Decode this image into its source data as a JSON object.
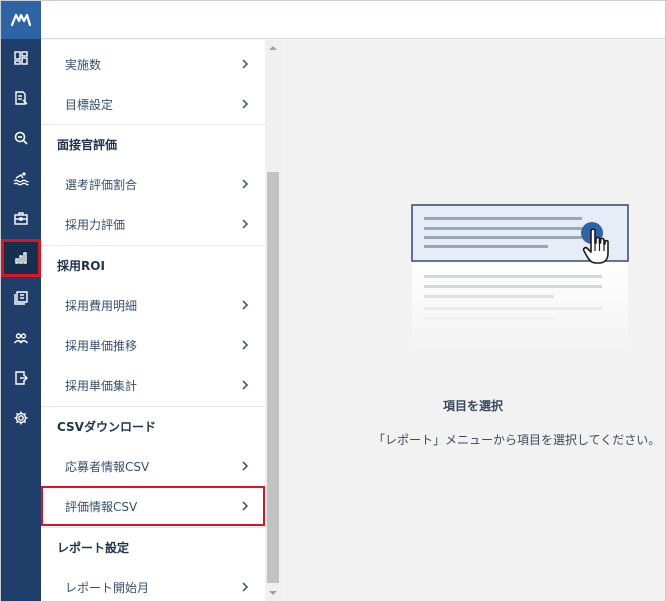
{
  "rail": {
    "logo_text": "M",
    "icons": [
      "dashboard-icon",
      "document-edit-icon",
      "search-icon",
      "swimmer-icon",
      "briefcase-icon",
      "bar-chart-icon",
      "tickets-icon",
      "users-icon",
      "export-icon",
      "gear-icon"
    ],
    "active_icon": "bar-chart-icon"
  },
  "menu": {
    "items": [
      {
        "type": "item",
        "label": "実施数"
      },
      {
        "type": "item",
        "label": "目標設定"
      },
      {
        "type": "section",
        "label": "面接官評価"
      },
      {
        "type": "item",
        "label": "選考評価割合"
      },
      {
        "type": "item",
        "label": "採用力評価"
      },
      {
        "type": "section",
        "label": "採用ROI"
      },
      {
        "type": "item",
        "label": "採用費用明細"
      },
      {
        "type": "item",
        "label": "採用単価推移"
      },
      {
        "type": "item",
        "label": "採用単価集計"
      },
      {
        "type": "section",
        "label": "CSVダウンロード"
      },
      {
        "type": "item",
        "label": "応募者情報CSV"
      },
      {
        "type": "item",
        "label": "評価情報CSV",
        "highlighted": true
      },
      {
        "type": "section",
        "label": "レポート設定"
      },
      {
        "type": "item",
        "label": "レポート開始月"
      }
    ]
  },
  "content": {
    "empty_title": "項目を選択",
    "empty_desc": "「レポート」メニューから項目を選択してください。"
  },
  "colors": {
    "rail": "#1f3f6a",
    "logo_bg": "#2e63a6",
    "highlight": "#e0141e",
    "content_bg": "#f2f2f2",
    "illustration_accent": "#2e63a6"
  }
}
